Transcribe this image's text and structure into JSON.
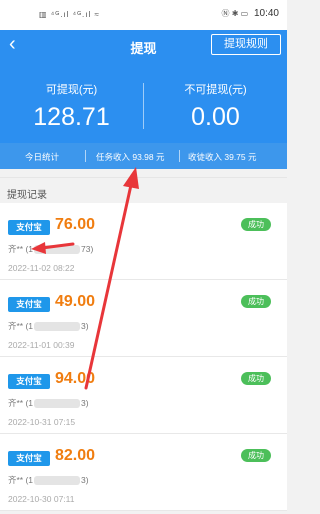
{
  "status_bar": {
    "left_icons": "▥ ⁴ᴳ.ıl ⁴ᴳ.ıl ≈",
    "right_icons": "Ⓝ ✱ ▭",
    "battery": "81",
    "time": "10:40"
  },
  "nav": {
    "back_icon": "chevron-left-icon",
    "title": "提现",
    "rules_button": "提现规则"
  },
  "summary": {
    "withdrawable_label": "可提现(元)",
    "withdrawable_value": "128.71",
    "non_withdrawable_label": "不可提现(元)",
    "non_withdrawable_value": "0.00"
  },
  "stats": {
    "today_label": "今日统计",
    "task_income": "任务收入 93.98 元",
    "gift_income": "收徒收入 39.75 元"
  },
  "section": {
    "title": "提现记录"
  },
  "records": [
    {
      "channel": "支付宝",
      "amount": "76.00",
      "status": "成功",
      "account_prefix": "齐** (1",
      "account_suffix": "73)",
      "time": "2022-11-02 08:22"
    },
    {
      "channel": "支付宝",
      "amount": "49.00",
      "status": "成功",
      "account_prefix": "齐** (1",
      "account_suffix": "3)",
      "time": "2022-11-01 00:39"
    },
    {
      "channel": "支付宝",
      "amount": "94.00",
      "status": "成功",
      "account_prefix": "齐** (1",
      "account_suffix": "3)",
      "time": "2022-10-31 07:15"
    },
    {
      "channel": "支付宝",
      "amount": "82.00",
      "status": "成功",
      "account_prefix": "齐** (1",
      "account_suffix": "3)",
      "time": "2022-10-30 07:11"
    }
  ],
  "colors": {
    "primary": "#2c8ff0",
    "amount": "#f07d10",
    "success": "#4cbf5a",
    "annotation_arrow": "#e8363a"
  }
}
